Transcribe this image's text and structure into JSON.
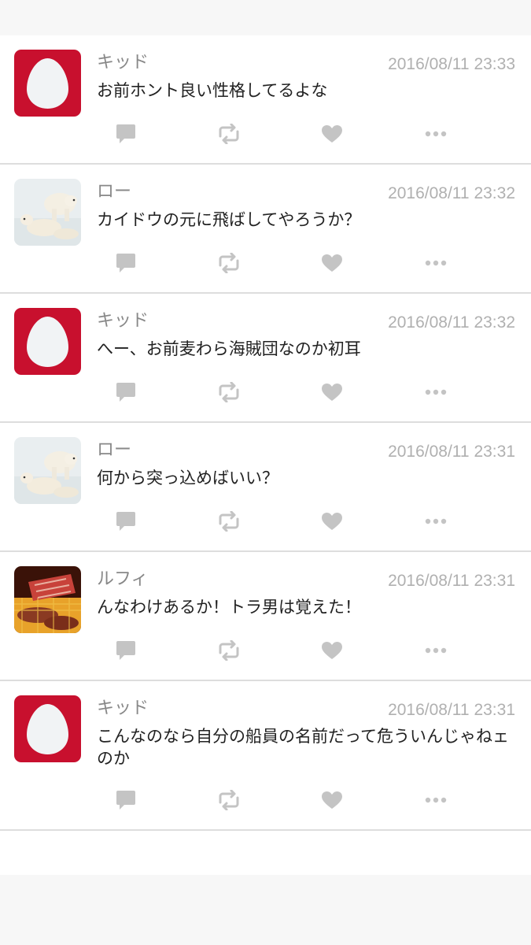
{
  "tweets": [
    {
      "avatar": "red-egg-avatar",
      "name": "キッド",
      "time": "2016/08/11 23:33",
      "text": "お前ホント良い性格してるよな"
    },
    {
      "avatar": "polar-bear-avatar",
      "name": "ロー",
      "time": "2016/08/11 23:32",
      "text": "カイドウの元に飛ばしてやろうか？"
    },
    {
      "avatar": "red-egg-avatar",
      "name": "キッド",
      "time": "2016/08/11 23:32",
      "text": "へー、お前麦わら海賊団なのか初耳"
    },
    {
      "avatar": "polar-bear-avatar",
      "name": "ロー",
      "time": "2016/08/11 23:31",
      "text": "何から突っ込めばいい？"
    },
    {
      "avatar": "grilled-meat-avatar",
      "name": "ルフィ",
      "time": "2016/08/11 23:31",
      "text": "んなわけあるか！トラ男は覚えた！"
    },
    {
      "avatar": "red-egg-avatar",
      "name": "キッド",
      "time": "2016/08/11 23:31",
      "text": "こんなのなら自分の船員の名前だって危ういんじゃねェのか"
    }
  ],
  "action_icons": [
    "reply-icon",
    "retweet-icon",
    "like-icon",
    "more-icon"
  ],
  "colors": {
    "egg_red": "#c8102e",
    "icon_gray": "#c4c4c4",
    "timestamp_gray": "#b0b0b0",
    "name_gray": "#888888",
    "divider": "#dddddd"
  }
}
